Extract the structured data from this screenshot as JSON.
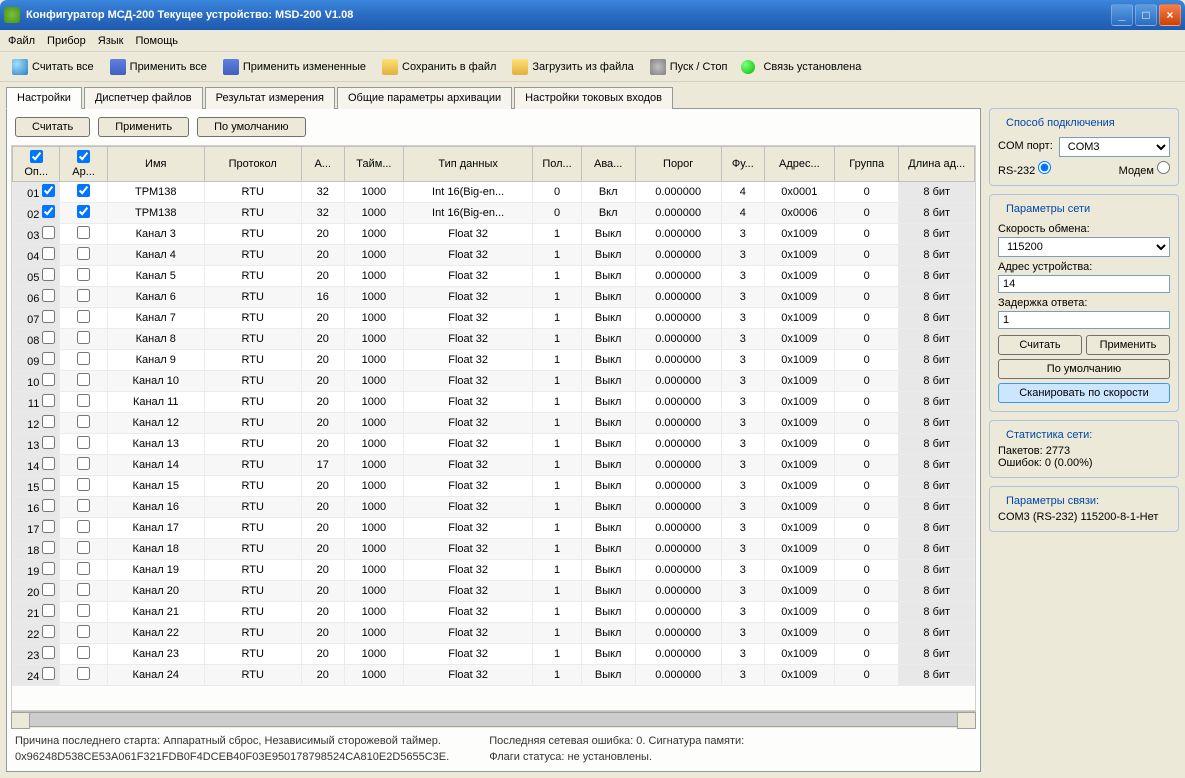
{
  "title": "Конфигуратор МСД-200   Текущее устройство: MSD-200 V1.08",
  "menu": {
    "file": "Файл",
    "device": "Прибор",
    "lang": "Язык",
    "help": "Помощь"
  },
  "toolbar": {
    "readall": "Считать все",
    "applyall": "Применить все",
    "applychanged": "Применить измененные",
    "savefile": "Сохранить в файл",
    "loadfile": "Загрузить из файла",
    "startstop": "Пуск / Стоп",
    "connstatus": "Связь установлена"
  },
  "tabs": {
    "t0": "Настройки",
    "t1": "Диспетчер файлов",
    "t2": "Результат измерения",
    "t3": "Общие параметры архивации",
    "t4": "Настройки токовых входов"
  },
  "buttons": {
    "read": "Считать",
    "apply": "Применить",
    "default": "По умолчанию"
  },
  "headers": {
    "op": "Оп...",
    "ar": "Ар...",
    "name": "Имя",
    "proto": "Протокол",
    "a": "А...",
    "time": "Тайм...",
    "dtype": "Тип данных",
    "pol": "Пол...",
    "ava": "Ава...",
    "thresh": "Порог",
    "fu": "Фу...",
    "addr": "Адрес...",
    "group": "Группа",
    "alen": "Длина ад..."
  },
  "rows": [
    {
      "n": "01",
      "op": true,
      "ar": true,
      "name": "ТРМ138",
      "proto": "RTU",
      "a": "32",
      "t": "1000",
      "dt": "Int 16(Big-en...",
      "pol": "0",
      "av": "Вкл",
      "th": "0.000000",
      "fu": "4",
      "addr": "0x0001",
      "g": "0",
      "al": "8 бит"
    },
    {
      "n": "02",
      "op": true,
      "ar": true,
      "name": "ТРМ138",
      "proto": "RTU",
      "a": "32",
      "t": "1000",
      "dt": "Int 16(Big-en...",
      "pol": "0",
      "av": "Вкл",
      "th": "0.000000",
      "fu": "4",
      "addr": "0x0006",
      "g": "0",
      "al": "8 бит"
    },
    {
      "n": "03",
      "op": false,
      "ar": false,
      "name": "Канал 3",
      "proto": "RTU",
      "a": "20",
      "t": "1000",
      "dt": "Float 32",
      "pol": "1",
      "av": "Выкл",
      "th": "0.000000",
      "fu": "3",
      "addr": "0x1009",
      "g": "0",
      "al": "8 бит"
    },
    {
      "n": "04",
      "op": false,
      "ar": false,
      "name": "Канал 4",
      "proto": "RTU",
      "a": "20",
      "t": "1000",
      "dt": "Float 32",
      "pol": "1",
      "av": "Выкл",
      "th": "0.000000",
      "fu": "3",
      "addr": "0x1009",
      "g": "0",
      "al": "8 бит"
    },
    {
      "n": "05",
      "op": false,
      "ar": false,
      "name": "Канал 5",
      "proto": "RTU",
      "a": "20",
      "t": "1000",
      "dt": "Float 32",
      "pol": "1",
      "av": "Выкл",
      "th": "0.000000",
      "fu": "3",
      "addr": "0x1009",
      "g": "0",
      "al": "8 бит"
    },
    {
      "n": "06",
      "op": false,
      "ar": false,
      "name": "Канал 6",
      "proto": "RTU",
      "a": "16",
      "t": "1000",
      "dt": "Float 32",
      "pol": "1",
      "av": "Выкл",
      "th": "0.000000",
      "fu": "3",
      "addr": "0x1009",
      "g": "0",
      "al": "8 бит"
    },
    {
      "n": "07",
      "op": false,
      "ar": false,
      "name": "Канал 7",
      "proto": "RTU",
      "a": "20",
      "t": "1000",
      "dt": "Float 32",
      "pol": "1",
      "av": "Выкл",
      "th": "0.000000",
      "fu": "3",
      "addr": "0x1009",
      "g": "0",
      "al": "8 бит"
    },
    {
      "n": "08",
      "op": false,
      "ar": false,
      "name": "Канал 8",
      "proto": "RTU",
      "a": "20",
      "t": "1000",
      "dt": "Float 32",
      "pol": "1",
      "av": "Выкл",
      "th": "0.000000",
      "fu": "3",
      "addr": "0x1009",
      "g": "0",
      "al": "8 бит"
    },
    {
      "n": "09",
      "op": false,
      "ar": false,
      "name": "Канал 9",
      "proto": "RTU",
      "a": "20",
      "t": "1000",
      "dt": "Float 32",
      "pol": "1",
      "av": "Выкл",
      "th": "0.000000",
      "fu": "3",
      "addr": "0x1009",
      "g": "0",
      "al": "8 бит"
    },
    {
      "n": "10",
      "op": false,
      "ar": false,
      "name": "Канал 10",
      "proto": "RTU",
      "a": "20",
      "t": "1000",
      "dt": "Float 32",
      "pol": "1",
      "av": "Выкл",
      "th": "0.000000",
      "fu": "3",
      "addr": "0x1009",
      "g": "0",
      "al": "8 бит"
    },
    {
      "n": "11",
      "op": false,
      "ar": false,
      "name": "Канал 11",
      "proto": "RTU",
      "a": "20",
      "t": "1000",
      "dt": "Float 32",
      "pol": "1",
      "av": "Выкл",
      "th": "0.000000",
      "fu": "3",
      "addr": "0x1009",
      "g": "0",
      "al": "8 бит"
    },
    {
      "n": "12",
      "op": false,
      "ar": false,
      "name": "Канал 12",
      "proto": "RTU",
      "a": "20",
      "t": "1000",
      "dt": "Float 32",
      "pol": "1",
      "av": "Выкл",
      "th": "0.000000",
      "fu": "3",
      "addr": "0x1009",
      "g": "0",
      "al": "8 бит"
    },
    {
      "n": "13",
      "op": false,
      "ar": false,
      "name": "Канал 13",
      "proto": "RTU",
      "a": "20",
      "t": "1000",
      "dt": "Float 32",
      "pol": "1",
      "av": "Выкл",
      "th": "0.000000",
      "fu": "3",
      "addr": "0x1009",
      "g": "0",
      "al": "8 бит"
    },
    {
      "n": "14",
      "op": false,
      "ar": false,
      "name": "Канал 14",
      "proto": "RTU",
      "a": "17",
      "t": "1000",
      "dt": "Float 32",
      "pol": "1",
      "av": "Выкл",
      "th": "0.000000",
      "fu": "3",
      "addr": "0x1009",
      "g": "0",
      "al": "8 бит"
    },
    {
      "n": "15",
      "op": false,
      "ar": false,
      "name": "Канал 15",
      "proto": "RTU",
      "a": "20",
      "t": "1000",
      "dt": "Float 32",
      "pol": "1",
      "av": "Выкл",
      "th": "0.000000",
      "fu": "3",
      "addr": "0x1009",
      "g": "0",
      "al": "8 бит"
    },
    {
      "n": "16",
      "op": false,
      "ar": false,
      "name": "Канал 16",
      "proto": "RTU",
      "a": "20",
      "t": "1000",
      "dt": "Float 32",
      "pol": "1",
      "av": "Выкл",
      "th": "0.000000",
      "fu": "3",
      "addr": "0x1009",
      "g": "0",
      "al": "8 бит"
    },
    {
      "n": "17",
      "op": false,
      "ar": false,
      "name": "Канал 17",
      "proto": "RTU",
      "a": "20",
      "t": "1000",
      "dt": "Float 32",
      "pol": "1",
      "av": "Выкл",
      "th": "0.000000",
      "fu": "3",
      "addr": "0x1009",
      "g": "0",
      "al": "8 бит"
    },
    {
      "n": "18",
      "op": false,
      "ar": false,
      "name": "Канал 18",
      "proto": "RTU",
      "a": "20",
      "t": "1000",
      "dt": "Float 32",
      "pol": "1",
      "av": "Выкл",
      "th": "0.000000",
      "fu": "3",
      "addr": "0x1009",
      "g": "0",
      "al": "8 бит"
    },
    {
      "n": "19",
      "op": false,
      "ar": false,
      "name": "Канал 19",
      "proto": "RTU",
      "a": "20",
      "t": "1000",
      "dt": "Float 32",
      "pol": "1",
      "av": "Выкл",
      "th": "0.000000",
      "fu": "3",
      "addr": "0x1009",
      "g": "0",
      "al": "8 бит"
    },
    {
      "n": "20",
      "op": false,
      "ar": false,
      "name": "Канал 20",
      "proto": "RTU",
      "a": "20",
      "t": "1000",
      "dt": "Float 32",
      "pol": "1",
      "av": "Выкл",
      "th": "0.000000",
      "fu": "3",
      "addr": "0x1009",
      "g": "0",
      "al": "8 бит"
    },
    {
      "n": "21",
      "op": false,
      "ar": false,
      "name": "Канал 21",
      "proto": "RTU",
      "a": "20",
      "t": "1000",
      "dt": "Float 32",
      "pol": "1",
      "av": "Выкл",
      "th": "0.000000",
      "fu": "3",
      "addr": "0x1009",
      "g": "0",
      "al": "8 бит"
    },
    {
      "n": "22",
      "op": false,
      "ar": false,
      "name": "Канал 22",
      "proto": "RTU",
      "a": "20",
      "t": "1000",
      "dt": "Float 32",
      "pol": "1",
      "av": "Выкл",
      "th": "0.000000",
      "fu": "3",
      "addr": "0x1009",
      "g": "0",
      "al": "8 бит"
    },
    {
      "n": "23",
      "op": false,
      "ar": false,
      "name": "Канал 23",
      "proto": "RTU",
      "a": "20",
      "t": "1000",
      "dt": "Float 32",
      "pol": "1",
      "av": "Выкл",
      "th": "0.000000",
      "fu": "3",
      "addr": "0x1009",
      "g": "0",
      "al": "8 бит"
    },
    {
      "n": "24",
      "op": false,
      "ar": false,
      "name": "Канал 24",
      "proto": "RTU",
      "a": "20",
      "t": "1000",
      "dt": "Float 32",
      "pol": "1",
      "av": "Выкл",
      "th": "0.000000",
      "fu": "3",
      "addr": "0x1009",
      "g": "0",
      "al": "8 бит"
    }
  ],
  "status": {
    "l1a": "Причина последнего старта: Аппаратный сброс, Независимый сторожевой таймер.",
    "l1b": "0x96248D538CE53A061F321FDB0F4DCEB40F03E950178798524CA810E2D5655C3E.",
    "r1": "Последняя сетевая ошибка: 0. Сигнатура памяти:",
    "r2": "Флаги статуса: не установлены."
  },
  "side": {
    "conn": {
      "title": "Способ подключения",
      "comport_l": "COM порт:",
      "comport": "COM3",
      "rs232": "RS-232",
      "modem": "Модем"
    },
    "net": {
      "title": "Параметры сети",
      "speed_l": "Скорость обмена:",
      "speed": "115200",
      "addr_l": "Адрес устройства:",
      "addr": "14",
      "delay_l": "Задержка ответа:",
      "delay": "1",
      "read": "Считать",
      "apply": "Применить",
      "default": "По умолчанию",
      "scan": "Сканировать по скорости"
    },
    "stat": {
      "title": "Статистика сети:",
      "packets": "Пакетов: 2773",
      "errors": "Ошибок: 0 (0.00%)"
    },
    "link": {
      "title": "Параметры связи:",
      "line": "COM3 (RS-232)  115200-8-1-Нет"
    }
  }
}
